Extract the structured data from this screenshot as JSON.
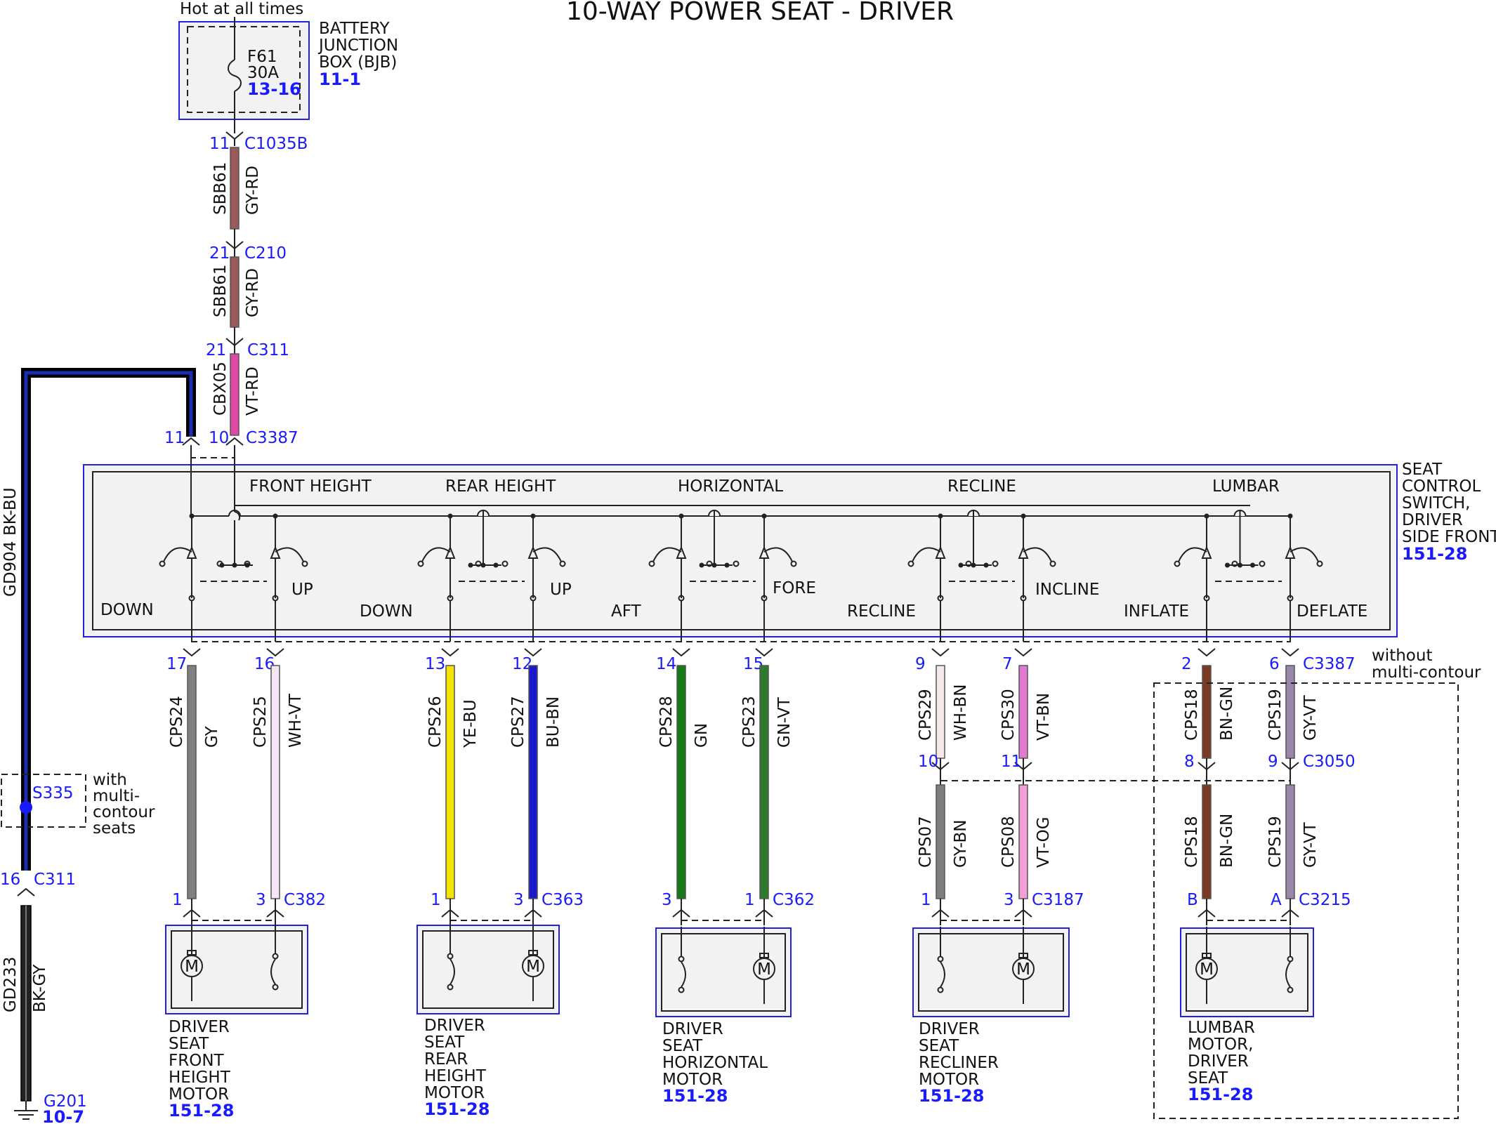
{
  "title": "10-WAY POWER SEAT - DRIVER",
  "colors": {
    "GY": "#808080",
    "WH-VT": "#f4e6f4",
    "YE-BU": "#f5e400",
    "BU-BN": "#1a1acc",
    "GN": "#157a15",
    "GN-VT": "#2c7a2c",
    "WH-BN": "#f4e8e8",
    "VT-BN": "#e07ad0",
    "BN-GN": "#7a3a24",
    "GY-VT": "#9a86a8",
    "GY-BN": "#7f7f7f",
    "VT-OG": "#f0a0d6",
    "GY-RD": "#9b5a5a",
    "VT-RD": "#e04aa6",
    "BK-BU": "#10208a",
    "BK-GY": "#222222"
  },
  "source": {
    "hot_label": "Hot at all times",
    "fuse_name": "F61",
    "fuse_rating": "30A",
    "fuse_ref": "13-16",
    "bjb_lines": [
      "BATTERY",
      "JUNCTION",
      "BOX (BJB)"
    ],
    "bjb_ref": "11-1"
  },
  "feed": {
    "c1035b_pin": "11",
    "c1035b": "C1035B",
    "sbb61_a": "SBB61",
    "gyrd_a": "GY-RD",
    "c210_pin": "21",
    "c210": "C210",
    "sbb61_b": "SBB61",
    "gyrd_b": "GY-RD",
    "c311_pin": "21",
    "c311": "C311",
    "cbx05": "CBX05",
    "vtrd": "VT-RD",
    "c3387_pin11": "11",
    "c3387_pin10": "10",
    "c3387": "C3387"
  },
  "ground": {
    "gd904": "GD904",
    "bkbu": "BK-BU",
    "s335": "S335",
    "s335_note": [
      "with",
      "multi-",
      "contour",
      "seats"
    ],
    "c311_pin": "16",
    "c311": "C311",
    "gd233": "GD233",
    "bkgy": "BK-GY",
    "g201": "G201",
    "g201_ref": "10-7"
  },
  "switch": {
    "name_lines": [
      "SEAT",
      "CONTROL",
      "SWITCH,",
      "DRIVER",
      "SIDE FRONT"
    ],
    "ref": "151-28",
    "sections": [
      "FRONT HEIGHT",
      "REAR HEIGHT",
      "HORIZONTAL",
      "RECLINE",
      "LUMBAR"
    ],
    "dirs": [
      "DOWN",
      "UP",
      "DOWN",
      "UP",
      "AFT",
      "FORE",
      "RECLINE",
      "INCLINE",
      "INFLATE",
      "DEFLATE"
    ]
  },
  "wires": [
    {
      "pin": "17",
      "circuit": "CPS24",
      "color": "GY",
      "mpin": "1"
    },
    {
      "pin": "16",
      "circuit": "CPS25",
      "color": "WH-VT",
      "mpin": "3",
      "conn": "C382"
    },
    {
      "pin": "13",
      "circuit": "CPS26",
      "color": "YE-BU",
      "mpin": "1"
    },
    {
      "pin": "12",
      "circuit": "CPS27",
      "color": "BU-BN",
      "mpin": "3",
      "conn": "C363"
    },
    {
      "pin": "14",
      "circuit": "CPS28",
      "color": "GN",
      "mpin": "3"
    },
    {
      "pin": "15",
      "circuit": "CPS23",
      "color": "GN-VT",
      "mpin": "1",
      "conn": "C362"
    },
    {
      "pin": "9",
      "circuit": "CPS29",
      "color": "WH-BN",
      "inpin": "10",
      "circuit2": "CPS07",
      "color2": "GY-BN",
      "mpin": "1"
    },
    {
      "pin": "7",
      "circuit": "CPS30",
      "color": "VT-BN",
      "inpin": "11",
      "circuit2": "CPS08",
      "color2": "VT-OG",
      "mpin": "3",
      "conn": "C3187"
    },
    {
      "pin": "2",
      "circuit": "CPS18",
      "color": "BN-GN",
      "inpin": "8",
      "circuit2": "CPS18",
      "color2": "BN-GN",
      "mpin": "B"
    },
    {
      "pin": "6",
      "circuit": "CPS19",
      "color": "GY-VT",
      "inpin": "9",
      "circuit2": "CPS19",
      "color2": "GY-VT",
      "mpin": "A",
      "conn": "C3215"
    }
  ],
  "connectors": {
    "c3387": "C3387",
    "c3050": "C3050"
  },
  "lumbar_note": [
    "without",
    "multi-contour"
  ],
  "motors": [
    {
      "lines": [
        "DRIVER",
        "SEAT",
        "FRONT",
        "HEIGHT",
        "MOTOR"
      ],
      "ref": "151-28",
      "symbol": "M"
    },
    {
      "lines": [
        "DRIVER",
        "SEAT",
        "REAR",
        "HEIGHT",
        "MOTOR"
      ],
      "ref": "151-28",
      "symbol": "M"
    },
    {
      "lines": [
        "DRIVER",
        "SEAT",
        "HORIZONTAL",
        "MOTOR"
      ],
      "ref": "151-28",
      "symbol": "M"
    },
    {
      "lines": [
        "DRIVER",
        "SEAT",
        "RECLINER",
        "MOTOR"
      ],
      "ref": "151-28",
      "symbol": "M"
    },
    {
      "lines": [
        "LUMBAR",
        "MOTOR,",
        "DRIVER",
        "SEAT"
      ],
      "ref": "151-28",
      "symbol": "M"
    }
  ]
}
